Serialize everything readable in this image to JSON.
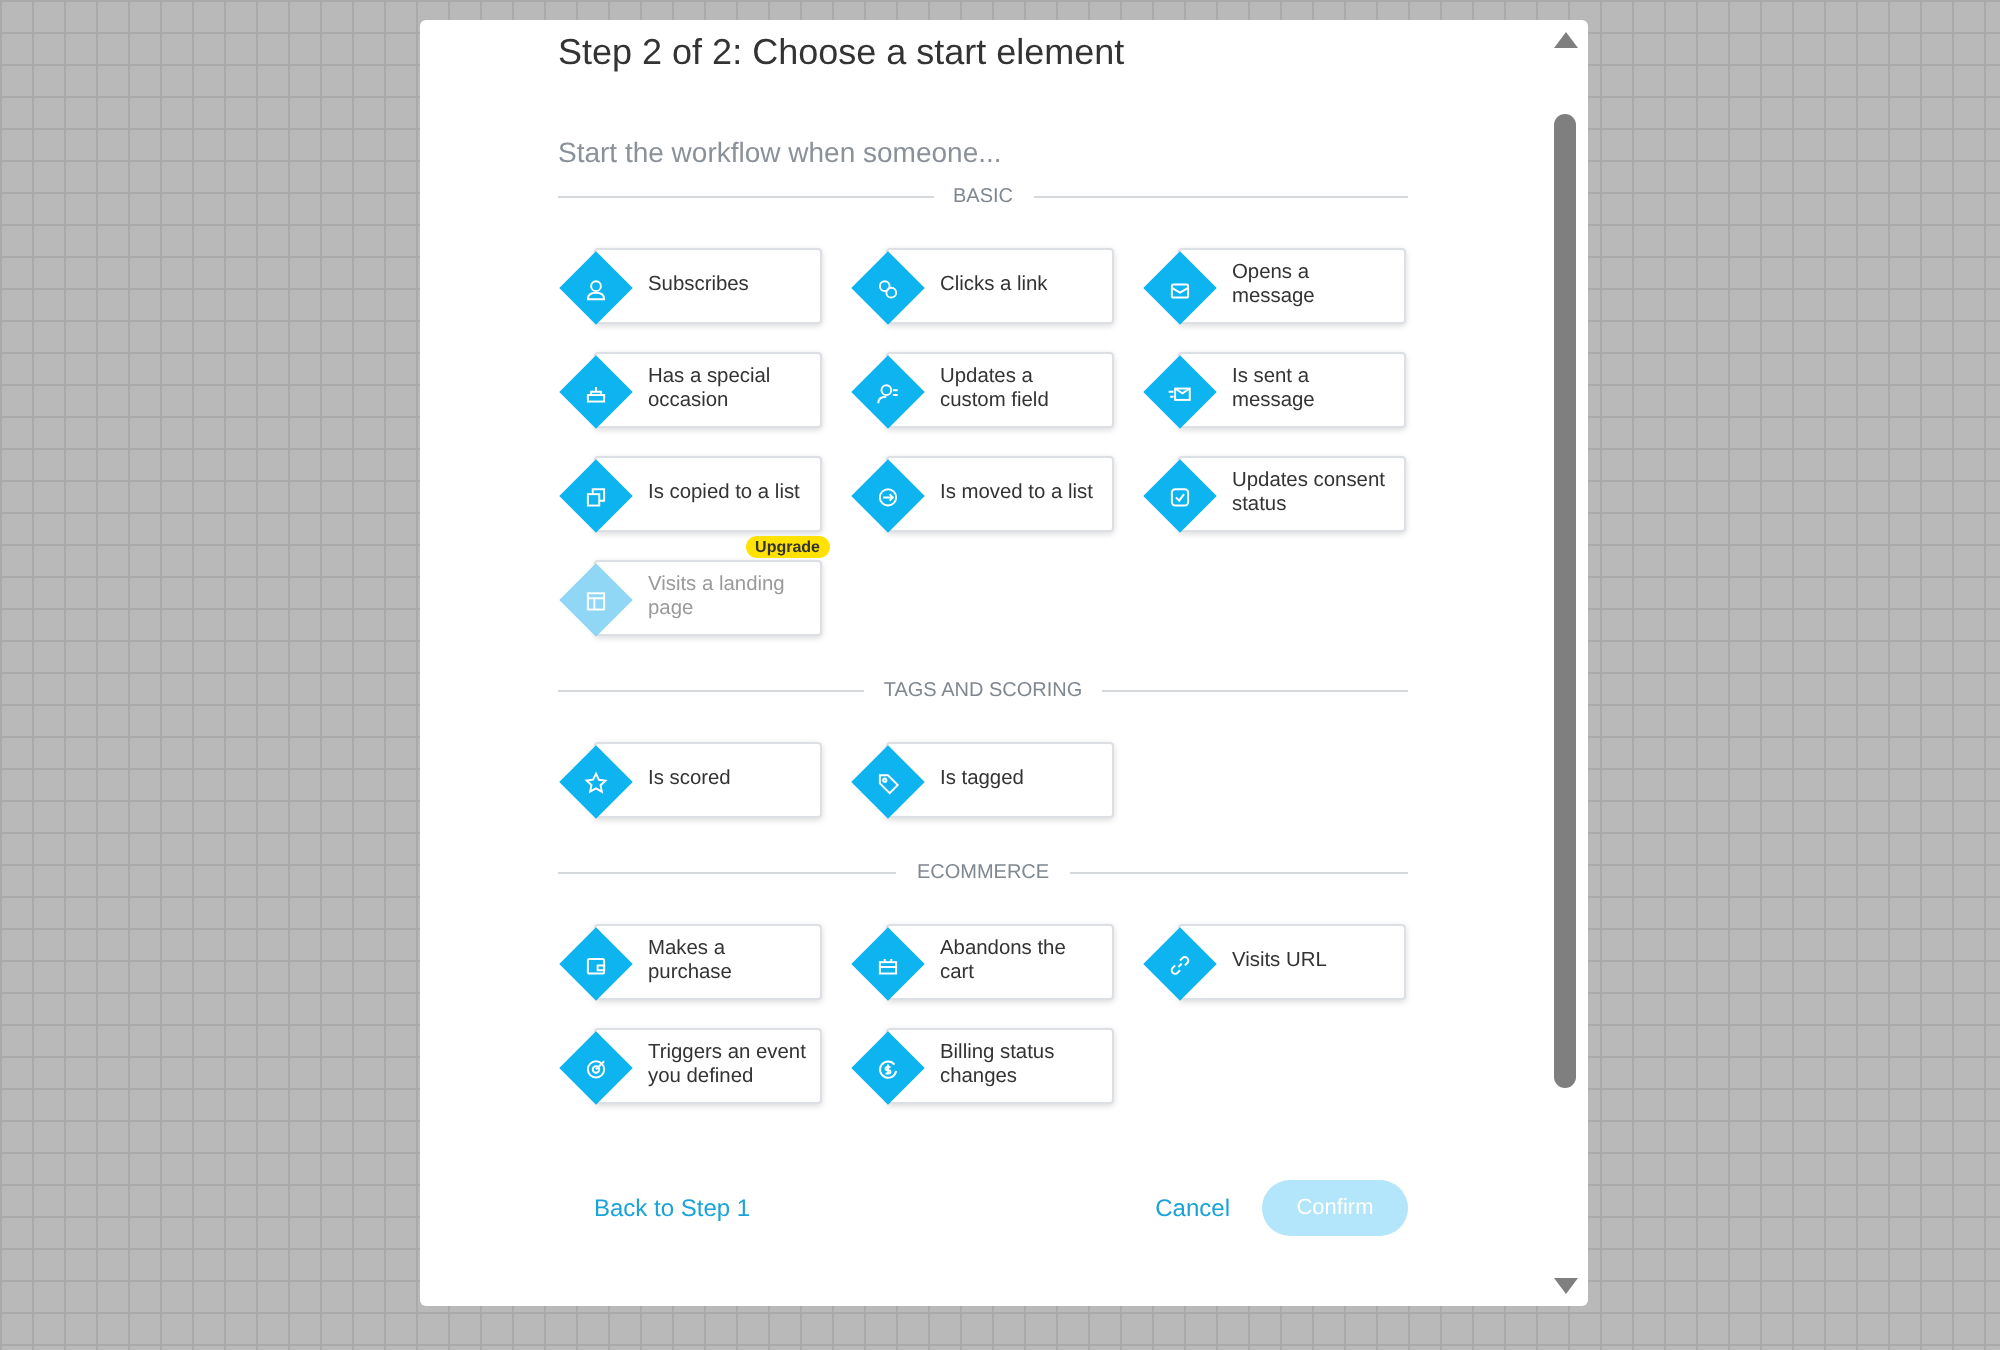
{
  "dialog": {
    "title": "Step 2 of 2: Choose a start element",
    "subtitle": "Start the workflow when someone..."
  },
  "sections": [
    {
      "heading": "BASIC",
      "items": [
        {
          "label": "Subscribes",
          "disabled": false
        },
        {
          "label": "Clicks a link",
          "disabled": false
        },
        {
          "label": "Opens a message",
          "disabled": false
        },
        {
          "label": "Has a special occasion",
          "disabled": false
        },
        {
          "label": "Updates a custom field",
          "disabled": false
        },
        {
          "label": "Is sent a message",
          "disabled": false
        },
        {
          "label": "Is copied to a list",
          "disabled": false
        },
        {
          "label": "Is moved to a list",
          "disabled": false
        },
        {
          "label": "Updates consent status",
          "disabled": false
        },
        {
          "label": "Visits a landing page",
          "disabled": true,
          "badge": "Upgrade"
        }
      ]
    },
    {
      "heading": "TAGS AND SCORING",
      "items": [
        {
          "label": "Is scored",
          "disabled": false
        },
        {
          "label": "Is tagged",
          "disabled": false
        }
      ]
    },
    {
      "heading": "ECOMMERCE",
      "items": [
        {
          "label": "Makes a purchase",
          "disabled": false
        },
        {
          "label": "Abandons the cart",
          "disabled": false
        },
        {
          "label": "Visits URL",
          "disabled": false
        },
        {
          "label": "Triggers an event you defined",
          "disabled": false
        },
        {
          "label": "Billing status changes",
          "disabled": false
        }
      ]
    }
  ],
  "footer": {
    "back": "Back to Step 1",
    "cancel": "Cancel",
    "confirm": {
      "label": "Confirm",
      "disabled": true
    }
  }
}
